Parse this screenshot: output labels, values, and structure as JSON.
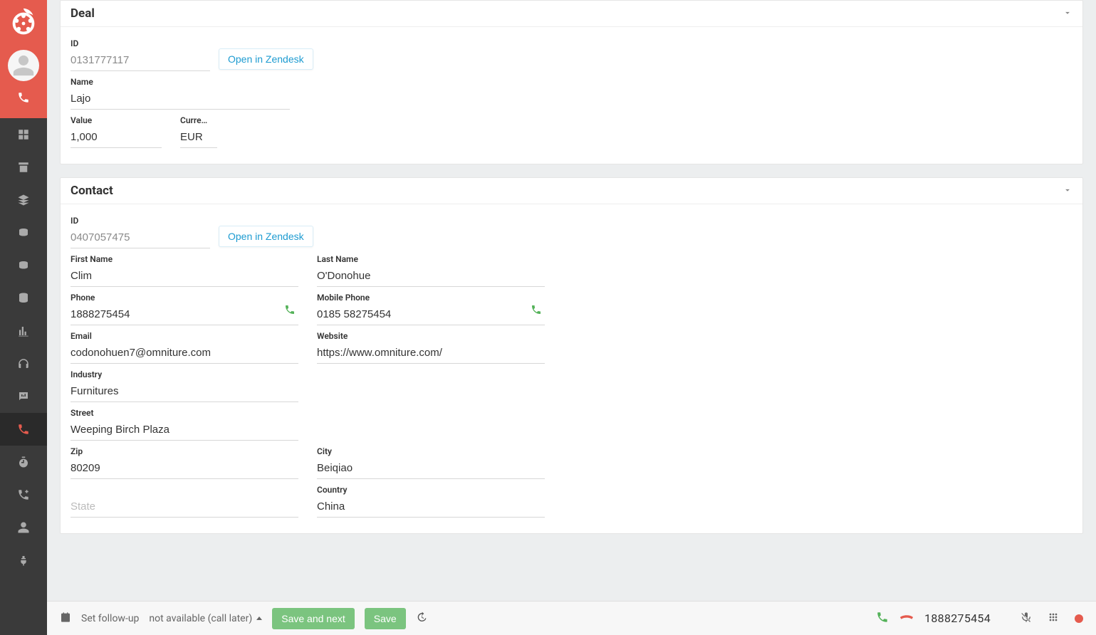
{
  "deal": {
    "title": "Deal",
    "id_label": "ID",
    "id": "0131777117",
    "open_zendesk": "Open in Zendesk",
    "name_label": "Name",
    "name": "Lajo",
    "value_label": "Value",
    "value": "1,000",
    "currency_label": "Curre…",
    "currency": "EUR"
  },
  "contact": {
    "title": "Contact",
    "id_label": "ID",
    "id": "0407057475",
    "open_zendesk": "Open in Zendesk",
    "first_name_label": "First Name",
    "first_name": "Clim",
    "last_name_label": "Last Name",
    "last_name": "O'Donohue",
    "phone_label": "Phone",
    "phone": "1888275454",
    "mobile_label": "Mobile Phone",
    "mobile": "0185 58275454",
    "email_label": "Email",
    "email": "codonohuen7@omniture.com",
    "website_label": "Website",
    "website": "https://www.omniture.com/",
    "industry_label": "Industry",
    "industry": "Furnitures",
    "street_label": "Street",
    "street": "Weeping Birch Plaza",
    "zip_label": "Zip",
    "zip": "80209",
    "city_label": "City",
    "city": "Beiqiao",
    "state_placeholder": "State",
    "country_label": "Country",
    "country": "China"
  },
  "footer": {
    "followup": "Set follow-up",
    "status": "not available (call later)",
    "save_next": "Save and next",
    "save": "Save",
    "number": "1888275454"
  }
}
